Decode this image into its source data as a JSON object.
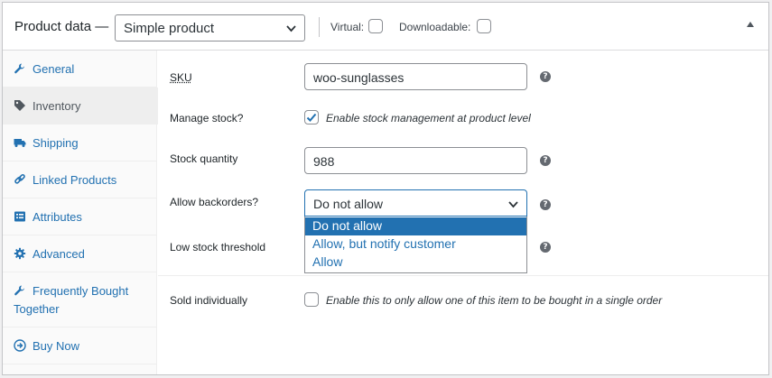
{
  "header": {
    "title": "Product data —",
    "product_type": "Simple product",
    "virtual_label": "Virtual:",
    "downloadable_label": "Downloadable:"
  },
  "sidebar": {
    "tabs": [
      {
        "label": "General",
        "icon": "wrench-icon"
      },
      {
        "label": "Inventory",
        "icon": "tag-icon"
      },
      {
        "label": "Shipping",
        "icon": "truck-icon"
      },
      {
        "label": "Linked Products",
        "icon": "link-icon"
      },
      {
        "label": "Attributes",
        "icon": "list-icon"
      },
      {
        "label": "Advanced",
        "icon": "gear-icon"
      },
      {
        "label": "Frequently Bought Together",
        "icon": "wrench-icon"
      },
      {
        "label": "Buy Now",
        "icon": "arrow-circle-icon"
      }
    ],
    "active_tab": "Inventory"
  },
  "fields": {
    "sku": {
      "label": "SKU",
      "value": "woo-sunglasses"
    },
    "manage_stock": {
      "label": "Manage stock?",
      "description": "Enable stock management at product level",
      "checked": true
    },
    "stock_quantity": {
      "label": "Stock quantity",
      "value": "988"
    },
    "backorders": {
      "label": "Allow backorders?",
      "value": "Do not allow",
      "options": [
        "Do not allow",
        "Allow, but notify customer",
        "Allow"
      ]
    },
    "low_stock": {
      "label": "Low stock threshold"
    },
    "sold_individually": {
      "label": "Sold individually",
      "description": "Enable this to only allow one of this item to be bought in a single order",
      "checked": false
    }
  },
  "colors": {
    "accent": "#2271b1",
    "help_icon": "#646970"
  }
}
